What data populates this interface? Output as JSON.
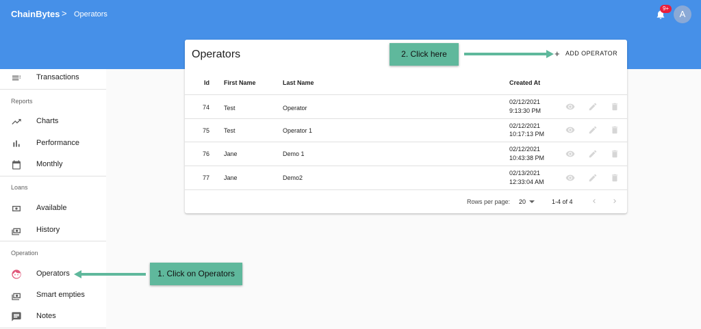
{
  "header": {
    "brand": "ChainBytes",
    "separator": ">",
    "breadcrumb": "Operators",
    "notification_badge": "9+",
    "avatar_initial": "A"
  },
  "sidebar": {
    "items_top": [
      {
        "label": "Transactions",
        "icon": "list-icon"
      }
    ],
    "sections": [
      {
        "title": "Reports",
        "items": [
          {
            "label": "Charts",
            "icon": "trending-up-icon"
          },
          {
            "label": "Performance",
            "icon": "bar-chart-icon"
          },
          {
            "label": "Monthly",
            "icon": "calendar-icon"
          }
        ]
      },
      {
        "title": "Loans",
        "items": [
          {
            "label": "Available",
            "icon": "money-icon"
          },
          {
            "label": "History",
            "icon": "money-stack-icon"
          }
        ]
      },
      {
        "title": "Operation",
        "items": [
          {
            "label": "Operators",
            "icon": "face-icon"
          },
          {
            "label": "Smart empties",
            "icon": "money-stack-icon"
          },
          {
            "label": "Notes",
            "icon": "notes-icon"
          }
        ]
      }
    ]
  },
  "operators": {
    "title": "Operators",
    "add_button": "ADD OPERATOR",
    "columns": [
      "Id",
      "First Name",
      "Last Name",
      "Created At"
    ],
    "rows": [
      {
        "id": "74",
        "first": "Test",
        "last": "Operator",
        "date": "02/12/2021",
        "time": "9:13:30 PM"
      },
      {
        "id": "75",
        "first": "Test",
        "last": "Operator 1",
        "date": "02/12/2021",
        "time": "10:17:13 PM"
      },
      {
        "id": "76",
        "first": "Jane",
        "last": "Demo 1",
        "date": "02/12/2021",
        "time": "10:43:38 PM"
      },
      {
        "id": "77",
        "first": "Jane",
        "last": "Demo2",
        "date": "02/13/2021",
        "time": "12:33:04 AM"
      }
    ],
    "footer": {
      "rows_per_page_label": "Rows per page:",
      "rows_per_page_value": "20",
      "range": "1-4 of 4"
    }
  },
  "annotations": {
    "step1": "1. Click on Operators",
    "step2": "2. Click here"
  },
  "colors": {
    "header": "#4690e8",
    "callout": "#5fb89c",
    "badge": "#e91e3c",
    "operators_icon": "#e0577a"
  }
}
